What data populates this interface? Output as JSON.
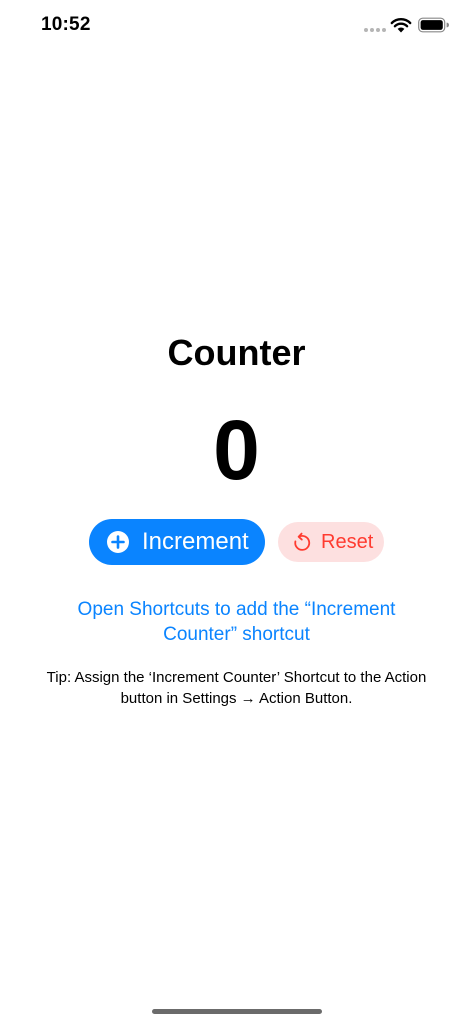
{
  "status_bar": {
    "time": "10:52"
  },
  "icons": {
    "wifi": "wifi-icon",
    "battery": "battery-icon",
    "plus": "plus-circle-icon",
    "reset": "counterclockwise-arrow-icon"
  },
  "colors": {
    "accent": "#0a84ff",
    "destructive": "#ff3b30",
    "destructive_bg": "#fde0e0"
  },
  "main": {
    "title": "Counter",
    "counter_value": "0",
    "increment_label": "Increment",
    "reset_label": "Reset",
    "shortcut_link": "Open Shortcuts to add the “Increment Counter” shortcut",
    "tip": "Tip: Assign the ‘Increment Counter’ Shortcut to the Action button in Settings → Action Button."
  }
}
